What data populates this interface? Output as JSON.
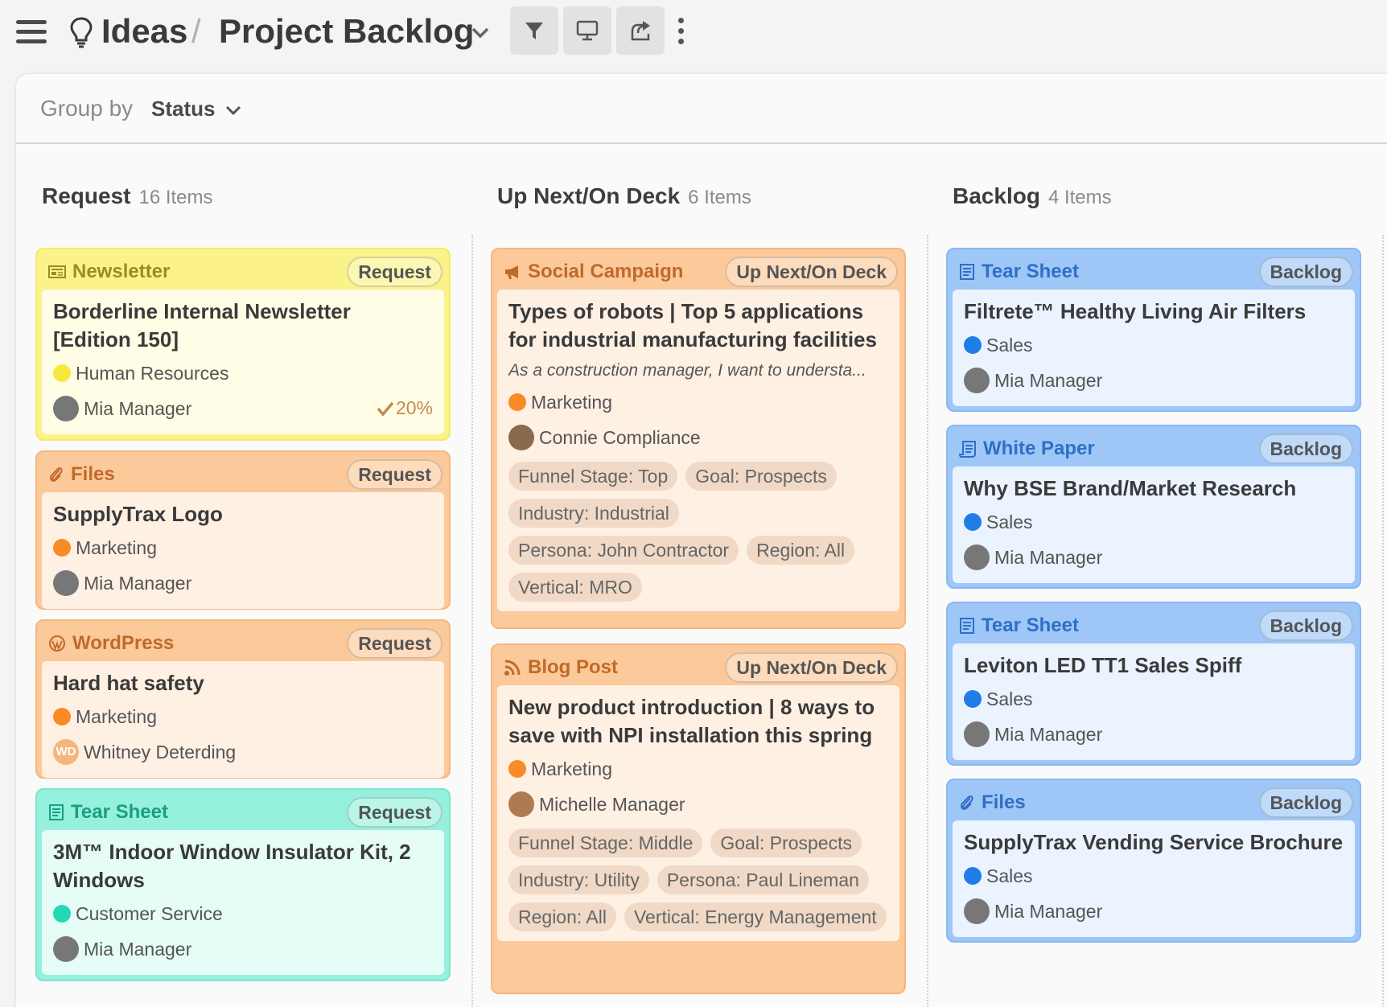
{
  "header": {
    "root": "Ideas",
    "separator": "/",
    "page": "Project Backlog"
  },
  "group_by": {
    "label": "Group by",
    "value": "Status"
  },
  "columns": [
    {
      "title": "Request",
      "count": "16 Items"
    },
    {
      "title": "Up Next/On Deck",
      "count": "6 Items"
    },
    {
      "title": "Backlog",
      "count": "4 Items"
    }
  ],
  "cards": {
    "request": [
      {
        "type": "Newsletter",
        "status": "Request",
        "title": "Borderline Internal Newsletter [Edition 150]",
        "dept": "Human Resources",
        "dept_color": "#f7e93b",
        "owner": "Mia Manager",
        "progress": "20%"
      },
      {
        "type": "Files",
        "status": "Request",
        "title": "SupplyTrax Logo",
        "dept": "Marketing",
        "dept_color": "#f98a25",
        "owner": "Mia Manager"
      },
      {
        "type": "WordPress",
        "status": "Request",
        "title": "Hard hat safety",
        "dept": "Marketing",
        "dept_color": "#f98a25",
        "owner": "Whitney Deterding",
        "owner_initials": "WD"
      },
      {
        "type": "Tear Sheet",
        "status": "Request",
        "title": "3M™ Indoor Window Insulator Kit, 2 Windows",
        "dept": "Customer Service",
        "dept_color": "#23d8b4",
        "owner": "Mia Manager"
      }
    ],
    "upnext": [
      {
        "type": "Social Campaign",
        "status": "Up Next/On Deck",
        "title": "Types of robots | Top 5 applications for industrial manufacturing facilities",
        "desc": "As a construction manager, I want to understa...",
        "dept": "Marketing",
        "dept_color": "#f98a25",
        "owner": "Connie Compliance",
        "tags": [
          "Funnel Stage: Top",
          "Goal: Prospects",
          "Industry: Industrial",
          "Persona: John Contractor",
          "Region: All",
          "Vertical: MRO"
        ]
      },
      {
        "type": "Blog Post",
        "status": "Up Next/On Deck",
        "title": "New product introduction | 8 ways to save with NPI installation this spring",
        "dept": "Marketing",
        "dept_color": "#f98a25",
        "owner": "Michelle Manager",
        "tags": [
          "Funnel Stage: Middle",
          "Goal: Prospects",
          "Industry: Utility",
          "Persona: Paul Lineman",
          "Region: All",
          "Vertical: Energy Management"
        ]
      }
    ],
    "backlog": [
      {
        "type": "Tear Sheet",
        "status": "Backlog",
        "title": "Filtrete™ Healthy Living Air Filters",
        "dept": "Sales",
        "dept_color": "#1f7de8",
        "owner": "Mia Manager"
      },
      {
        "type": "White Paper",
        "status": "Backlog",
        "title": "Why BSE Brand/Market Research",
        "dept": "Sales",
        "dept_color": "#1f7de8",
        "owner": "Mia Manager"
      },
      {
        "type": "Tear Sheet",
        "status": "Backlog",
        "title": "Leviton LED TT1 Sales Spiff",
        "dept": "Sales",
        "dept_color": "#1f7de8",
        "owner": "Mia Manager"
      },
      {
        "type": "Files",
        "status": "Backlog",
        "title": "SupplyTrax Vending Service Brochure",
        "dept": "Sales",
        "dept_color": "#1f7de8",
        "owner": "Mia Manager"
      }
    ]
  },
  "icons": {
    "menu": "hamburger-icon",
    "lightbulb": "lightbulb-icon",
    "filter": "filter-icon",
    "present": "monitor-icon",
    "share": "share-icon",
    "more": "kebab-icon"
  }
}
